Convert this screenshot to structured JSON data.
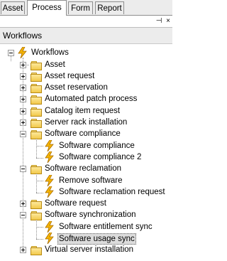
{
  "tabs": [
    {
      "label": "Asset",
      "active": false
    },
    {
      "label": "Process",
      "active": true
    },
    {
      "label": "Form",
      "active": false
    },
    {
      "label": "Report",
      "active": false
    }
  ],
  "panel": {
    "title": "Workflows",
    "pin_glyph": "⊣",
    "close_glyph": "×"
  },
  "tree": {
    "root": {
      "label": "Workflows",
      "icon": "lightning-icon",
      "expanded": true
    },
    "nodes": [
      {
        "label": "Asset",
        "type": "folder",
        "expanded": false
      },
      {
        "label": "Asset request",
        "type": "folder",
        "expanded": false
      },
      {
        "label": "Asset reservation",
        "type": "folder",
        "expanded": false
      },
      {
        "label": "Automated patch process",
        "type": "folder",
        "expanded": false
      },
      {
        "label": "Catalog item request",
        "type": "folder",
        "expanded": false
      },
      {
        "label": "Server rack installation",
        "type": "folder",
        "expanded": false
      },
      {
        "label": "Software compliance",
        "type": "folder",
        "expanded": true,
        "children": [
          {
            "label": "Software compliance",
            "type": "workflow"
          },
          {
            "label": "Software compliance 2",
            "type": "workflow"
          }
        ]
      },
      {
        "label": "Software reclamation",
        "type": "folder",
        "expanded": true,
        "children": [
          {
            "label": "Remove software",
            "type": "workflow"
          },
          {
            "label": "Software reclamation request",
            "type": "workflow"
          }
        ]
      },
      {
        "label": "Software request",
        "type": "folder",
        "expanded": false
      },
      {
        "label": "Software synchronization",
        "type": "folder",
        "expanded": true,
        "children": [
          {
            "label": "Software entitlement sync",
            "type": "workflow"
          },
          {
            "label": "Software usage sync",
            "type": "workflow",
            "selected": true
          }
        ]
      },
      {
        "label": "Virtual server installation",
        "type": "folder",
        "expanded": false
      }
    ]
  },
  "colors": {
    "selection_bg": "#dcdcdc",
    "folder_fill": "#f2c94b",
    "bolt_fill": "#f5b400"
  }
}
